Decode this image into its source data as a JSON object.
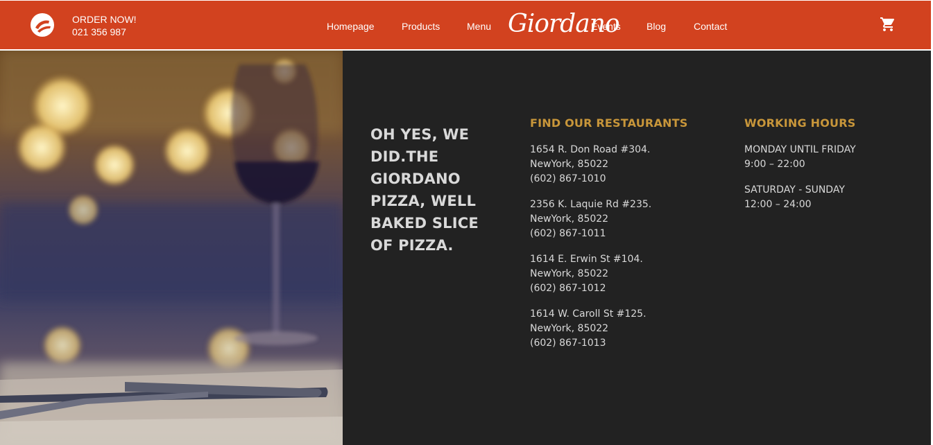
{
  "header": {
    "order_label": "ORDER NOW!",
    "phone": "021 356 987",
    "logo": "Giordano",
    "nav": [
      "Homepage",
      "Products",
      "Menu",
      "Events",
      "Blog",
      "Contact"
    ],
    "cart_icon": "shopping-cart-icon",
    "badge_icon": "pizza-badge-icon"
  },
  "colors": {
    "header_bg": "#d2421f",
    "panel_bg": "#222222",
    "accent": "#c8963a",
    "text": "#d9d9d9"
  },
  "tagline": "OH YES, WE DID.THE GIORDANO PIZZA, WELL BAKED SLICE OF PIZZA.",
  "restaurants": {
    "title": "FIND OUR RESTAURANTS",
    "items": [
      {
        "street": "1654 R. Don Road #304.",
        "city": "NewYork, 85022",
        "phone": "(602) 867-1010"
      },
      {
        "street": "2356 K. Laquie Rd #235.",
        "city": "NewYork, 85022",
        "phone": "(602) 867-1011"
      },
      {
        "street": "1614 E. Erwin St #104.",
        "city": "NewYork, 85022",
        "phone": "(602) 867-1012"
      },
      {
        "street": "1614 W. Caroll St #125.",
        "city": "NewYork, 85022",
        "phone": "(602) 867-1013"
      }
    ]
  },
  "hours": {
    "title": "WORKING HOURS",
    "items": [
      {
        "days": "MONDAY UNTIL FRIDAY",
        "time": "9:00 – 22:00"
      },
      {
        "days": "SATURDAY - SUNDAY",
        "time": "12:00 – 24:00"
      }
    ]
  }
}
